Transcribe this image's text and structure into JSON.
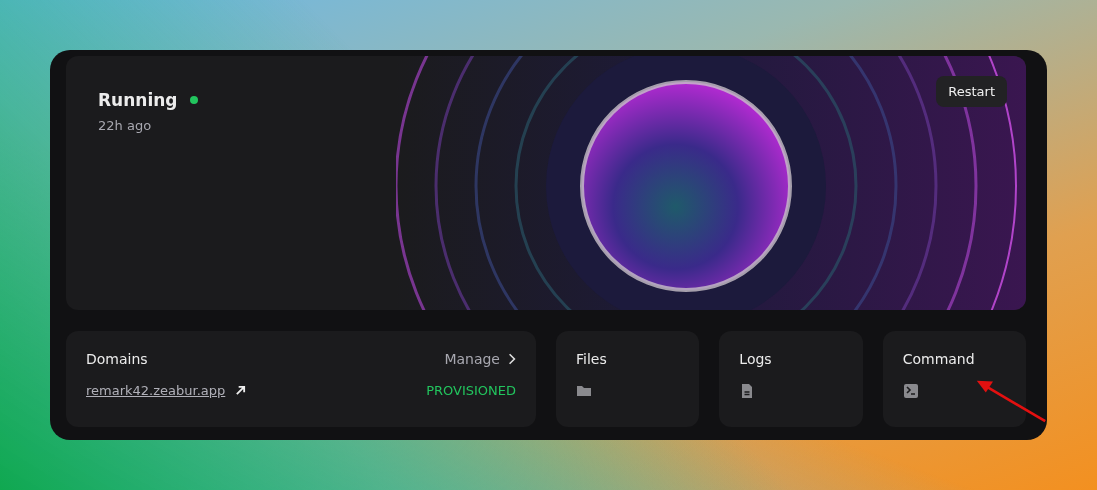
{
  "status": {
    "label": "Running",
    "color": "#22c55e",
    "time": "22h ago",
    "action": "Restart"
  },
  "cards": [
    {
      "kind": "domains",
      "title": "Domains",
      "manage": "Manage",
      "domain": "remark42.zeabur.app",
      "state": "PROVISIONED"
    },
    {
      "kind": "files",
      "title": "Files"
    },
    {
      "kind": "logs",
      "title": "Logs"
    },
    {
      "kind": "command",
      "title": "Command"
    }
  ]
}
